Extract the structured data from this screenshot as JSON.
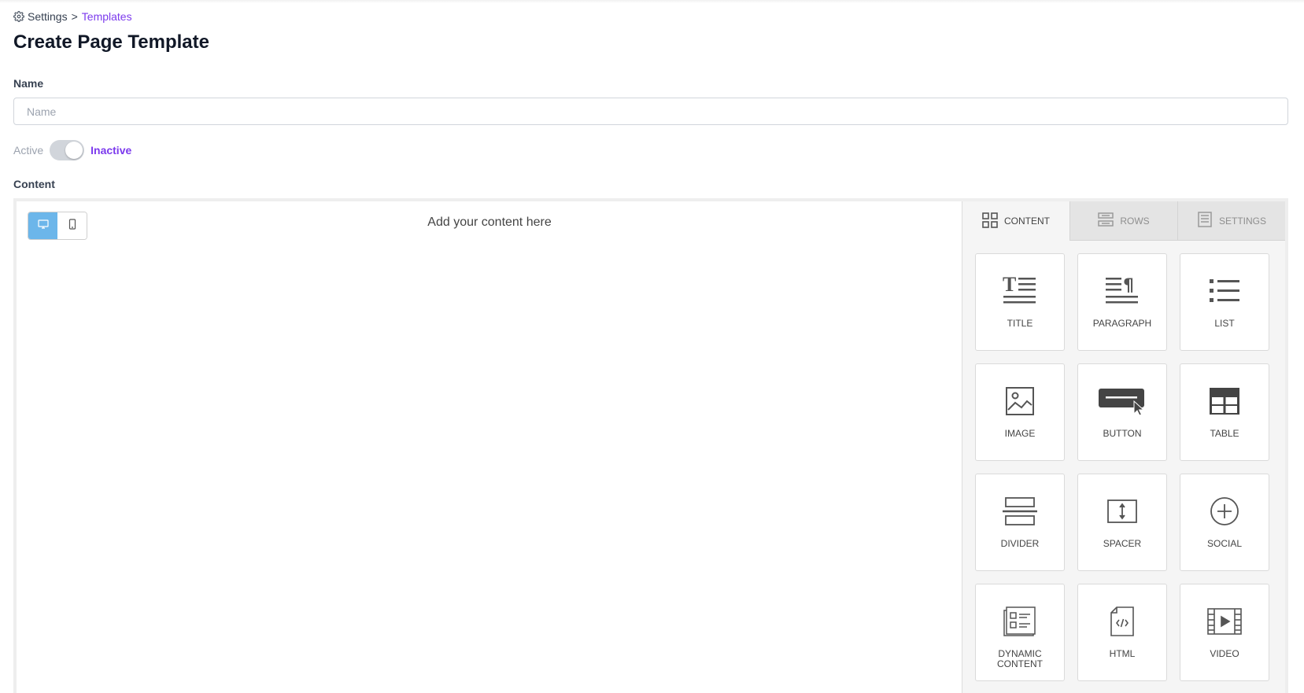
{
  "breadcrumb": {
    "icon": "gear-icon",
    "parent": "Settings",
    "separator": ">",
    "current": "Templates"
  },
  "page": {
    "title": "Create Page Template"
  },
  "form": {
    "name_label": "Name",
    "name_placeholder": "Name",
    "name_value": "",
    "status": {
      "off_label": "Active",
      "on_label": "Inactive",
      "checked": true
    },
    "content_label": "Content"
  },
  "editor": {
    "device_buttons": [
      {
        "name": "desktop",
        "icon": "desktop-icon",
        "active": true
      },
      {
        "name": "mobile",
        "icon": "mobile-icon",
        "active": false
      }
    ],
    "canvas_placeholder": "Add your content here",
    "tabs": [
      {
        "label": "CONTENT",
        "icon": "grid-icon",
        "active": true
      },
      {
        "label": "ROWS",
        "icon": "rows-icon",
        "active": false
      },
      {
        "label": "SETTINGS",
        "icon": "settings-icon",
        "active": false
      }
    ],
    "blocks": [
      {
        "label": "TITLE",
        "icon": "title-icon"
      },
      {
        "label": "PARAGRAPH",
        "icon": "paragraph-icon"
      },
      {
        "label": "LIST",
        "icon": "list-icon"
      },
      {
        "label": "IMAGE",
        "icon": "image-icon"
      },
      {
        "label": "BUTTON",
        "icon": "button-icon"
      },
      {
        "label": "TABLE",
        "icon": "table-icon"
      },
      {
        "label": "DIVIDER",
        "icon": "divider-icon"
      },
      {
        "label": "SPACER",
        "icon": "spacer-icon"
      },
      {
        "label": "SOCIAL",
        "icon": "social-icon"
      },
      {
        "label": "DYNAMIC CONTENT",
        "icon": "dynamic-content-icon"
      },
      {
        "label": "HTML",
        "icon": "html-icon"
      },
      {
        "label": "VIDEO",
        "icon": "video-icon"
      }
    ]
  },
  "colors": {
    "accent": "#7c3aed",
    "device_active": "#6cb6ea",
    "toggle_track": "#d1d5db",
    "icon": "#555555"
  }
}
